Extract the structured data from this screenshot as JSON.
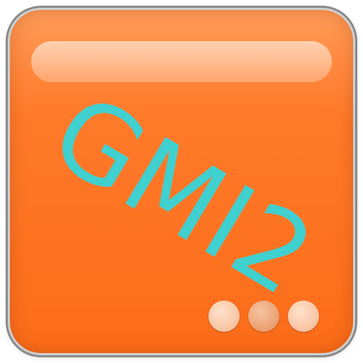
{
  "icon": {
    "label": "GMI2",
    "background_color": "#fb6c19",
    "label_color": "#3fd0cf",
    "dots": [
      {
        "name": "dot-light",
        "color": "#f4b690"
      },
      {
        "name": "dot-dark",
        "color": "#e48f5c"
      },
      {
        "name": "dot-light",
        "color": "#f4b690"
      }
    ]
  }
}
